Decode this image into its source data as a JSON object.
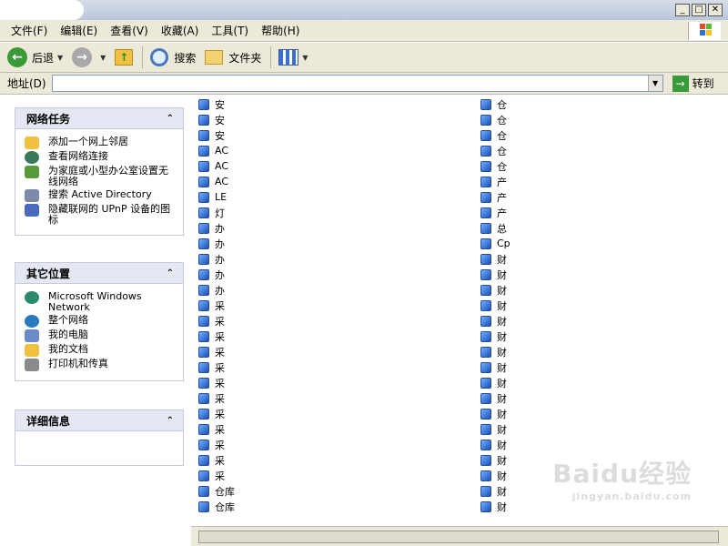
{
  "menu": [
    "文件(F)",
    "编辑(E)",
    "查看(V)",
    "收藏(A)",
    "工具(T)",
    "帮助(H)"
  ],
  "toolbar": {
    "back": "后退",
    "search": "搜索",
    "folders": "文件夹"
  },
  "address": {
    "label": "地址(D)",
    "go": "转到"
  },
  "panels": [
    {
      "title": "网络任务",
      "items": [
        "添加一个网上邻居",
        "查看网络连接",
        "为家庭或小型办公室设置无线网络",
        "搜索 Active Directory",
        "隐藏联网的 UPnP 设备的图标"
      ]
    },
    {
      "title": "其它位置",
      "items": [
        "Microsoft Windows Network",
        "整个网络",
        "我的电脑",
        "我的文档",
        "打印机和传真"
      ]
    },
    {
      "title": "详细信息",
      "items": []
    }
  ],
  "list_col1": [
    "安",
    "安",
    "安",
    "AC",
    "AC",
    "AC",
    "LE",
    "灯",
    "办",
    "办",
    "办",
    "办",
    "办",
    "采",
    "采",
    "采",
    "采",
    "采",
    "采",
    "采",
    "采",
    "采",
    "采",
    "采",
    "采",
    "仓库",
    "仓库"
  ],
  "list_col2": [
    "仓",
    "仓",
    "仓",
    "仓",
    "仓",
    "产",
    "产",
    "产",
    "总",
    "Cp",
    "财",
    "财",
    "财",
    "财",
    "财",
    "财",
    "财",
    "财",
    "财",
    "财",
    "财",
    "财",
    "财",
    "财",
    "财",
    "财",
    "财"
  ],
  "watermark": {
    "brand": "Baidu经验",
    "url": "jingyan.baidu.com"
  }
}
